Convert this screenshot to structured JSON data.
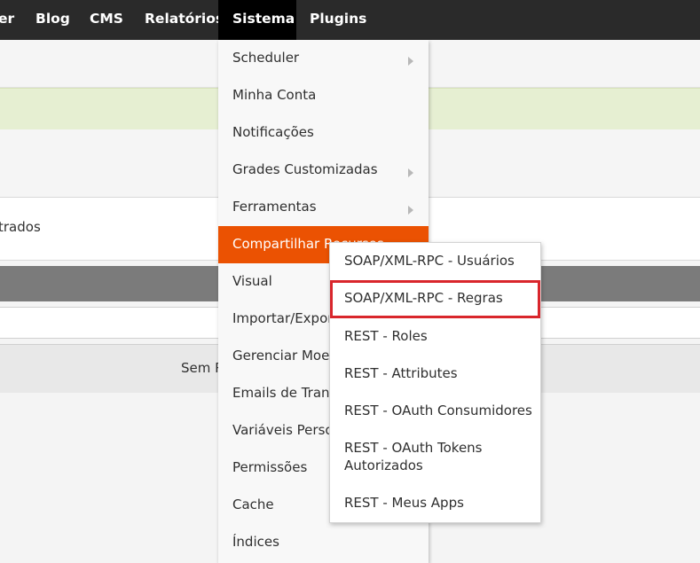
{
  "nav": {
    "items": [
      {
        "label": "er"
      },
      {
        "label": "Blog"
      },
      {
        "label": "CMS"
      },
      {
        "label": "Relatórios"
      },
      {
        "label": "Sistema",
        "active": true
      },
      {
        "label": "Plugins"
      }
    ]
  },
  "background": {
    "row_text": "trados",
    "empty_text": "Sem R"
  },
  "menu": {
    "items": [
      {
        "label": "Scheduler",
        "has_submenu": true
      },
      {
        "label": "Minha Conta"
      },
      {
        "label": "Notificações"
      },
      {
        "label": "Grades Customizadas",
        "has_submenu": true
      },
      {
        "label": "Ferramentas",
        "has_submenu": true
      },
      {
        "label": "Compartilhar Recursos",
        "highlighted": true
      },
      {
        "label": "Visual"
      },
      {
        "label": "Importar/Expor"
      },
      {
        "label": "Gerenciar Moed"
      },
      {
        "label": "Emails de Trans"
      },
      {
        "label": "Variáveis Perso"
      },
      {
        "label": "Permissões"
      },
      {
        "label": "Cache"
      },
      {
        "label": "Índices"
      }
    ]
  },
  "submenu": {
    "items": [
      {
        "label": "SOAP/XML-RPC - Usuários"
      },
      {
        "label": "SOAP/XML-RPC - Regras",
        "selected": true
      },
      {
        "label": "REST - Roles"
      },
      {
        "label": "REST - Attributes"
      },
      {
        "label": "REST - OAuth Consumidores"
      },
      {
        "label": "REST - OAuth Tokens Autorizados"
      },
      {
        "label": "REST - Meus Apps"
      }
    ]
  },
  "colors": {
    "nav_bg": "#2a2a2a",
    "nav_active_bg": "#000000",
    "highlight": "#eb5202",
    "selection_outline": "#d9262c",
    "success_band": "#e6efd2"
  },
  "icons": {
    "submenu_arrow": "chevron-right-icon"
  }
}
